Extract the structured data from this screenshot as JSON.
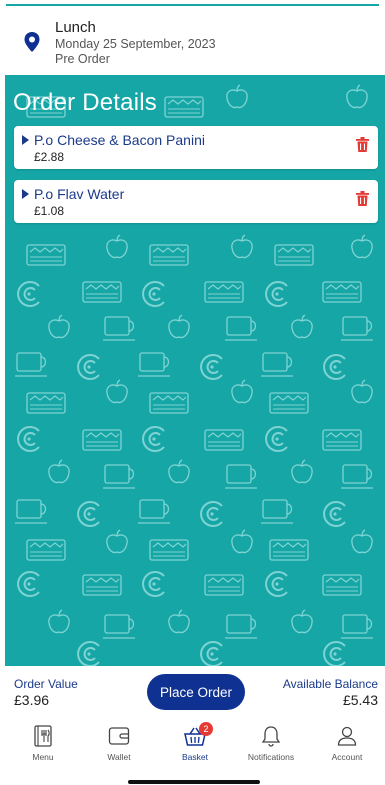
{
  "header": {
    "title": "Lunch",
    "date": "Monday 25 September, 2023",
    "subtitle": "Pre Order",
    "icon": "location-pin-icon"
  },
  "order": {
    "heading": "Order Details",
    "items": [
      {
        "name": "P.o Cheese & Bacon Panini",
        "price": "£2.88"
      },
      {
        "name": "P.o Flav Water",
        "price": "£1.08"
      }
    ]
  },
  "summary": {
    "order_value_label": "Order Value",
    "order_value": "£3.96",
    "place_order_label": "Place Order",
    "available_balance_label": "Available Balance",
    "available_balance": "£5.43"
  },
  "nav": {
    "items": [
      {
        "label": "Menu",
        "icon": "menu-book-icon"
      },
      {
        "label": "Wallet",
        "icon": "wallet-icon"
      },
      {
        "label": "Basket",
        "icon": "basket-icon",
        "badge": "2",
        "active": true
      },
      {
        "label": "Notifications",
        "icon": "bell-icon"
      },
      {
        "label": "Account",
        "icon": "person-icon"
      }
    ]
  },
  "colors": {
    "accent_teal": "#16a6a6",
    "primary_blue": "#0f3192",
    "link_blue": "#1b3a8a",
    "delete_red": "#e53935"
  }
}
